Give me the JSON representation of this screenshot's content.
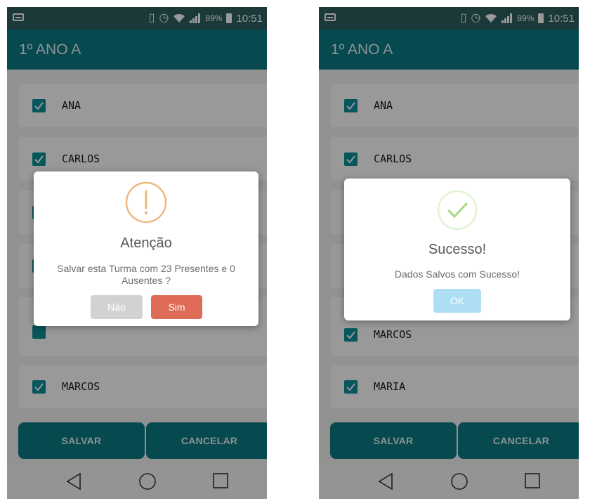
{
  "statusbar": {
    "battery": "89%",
    "time": "10:51"
  },
  "left": {
    "title": "1º ANO A",
    "students": [
      "ANA",
      "CARLOS",
      "",
      "",
      "",
      "MARCOS"
    ],
    "buttons": {
      "save": "SALVAR",
      "cancel": "CANCELAR"
    },
    "dialog": {
      "icon": "warning-icon",
      "title": "Atenção",
      "message_line1": "Salvar esta Turma com 23 Presentes e 0",
      "message_line2": "Ausentes ?",
      "no_label": "Não",
      "yes_label": "Sim",
      "colors": {
        "warning": "#f0b87c",
        "no": "#d2d2d2",
        "yes": "#dd6b55"
      }
    }
  },
  "right": {
    "title": "1º ANO A",
    "students": [
      "ANA",
      "CARLOS",
      "",
      "",
      "MARCOS",
      "MARIA"
    ],
    "buttons": {
      "save": "SALVAR",
      "cancel": "CANCELAR"
    },
    "dialog": {
      "icon": "success-check-icon",
      "title": "Sucesso!",
      "message": "Dados Salvos com Sucesso!",
      "ok_label": "OK",
      "colors": {
        "success": "#a5dc86",
        "ok": "#aedef4"
      }
    }
  },
  "colors": {
    "appbar": "#0a7b84",
    "statusbar": "#2f5f61",
    "checkbox": "#0a8f99"
  }
}
